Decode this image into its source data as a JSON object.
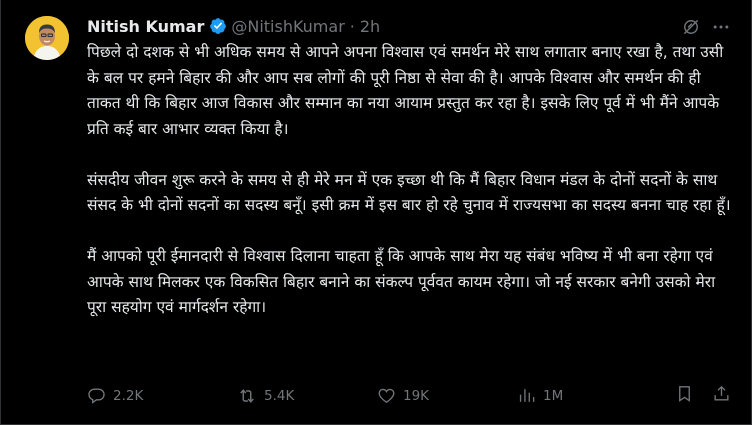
{
  "author": {
    "name": "Nitish Kumar",
    "handle": "@NitishKumar",
    "separator": "·",
    "time": "2h"
  },
  "body": {
    "p1": "पिछले दो दशक से भी अधिक समय से आपने अपना विश्वास एवं समर्थन मेरे साथ लगातार बनाए रखा है, तथा उसी के बल पर हमने बिहार की और आप सब लोगों की पूरी निष्ठा से सेवा की है। आपके विश्वास और समर्थन की ही ताकत थी कि बिहार आज विकास और सम्मान का नया आयाम प्रस्तुत कर रहा है। इसके लिए पूर्व में भी मैंने आपके प्रति कई बार आभार व्यक्त किया है।",
    "p2": "संसदीय जीवन शुरू करने के समय से ही मेरे मन में एक इच्छा थी कि मैं बिहार विधान मंडल के दोनों सदनों के साथ संसद के भी दोनों सदनों का सदस्य बनूँ। इसी क्रम में इस बार हो रहे चुनाव में राज्यसभा का सदस्य बनना चाह रहा हूँ।",
    "p3": "मैं आपको पूरी ईमानदारी से विश्वास दिलाना चाहता हूँ कि आपके साथ मेरा यह संबंध भविष्य में भी बना रहेगा एवं आपके साथ मिलकर एक विकसित बिहार बनाने का संकल्प पूर्ववत कायम रहेगा। जो नई सरकार बनेगी उसको मेरा पूरा सहयोग एवं मार्गदर्शन रहेगा।"
  },
  "stats": {
    "replies": "2.2K",
    "reposts": "5.4K",
    "likes": "19K",
    "views": "1M"
  },
  "icons": {
    "verified": "verified-badge-icon",
    "grok": "grok-icon",
    "more": "more-icon",
    "reply": "reply-icon",
    "repost": "repost-icon",
    "like": "like-icon",
    "views": "views-icon",
    "bookmark": "bookmark-icon",
    "share": "share-icon"
  },
  "colors": {
    "background": "#000000",
    "text": "#e7e9ea",
    "muted": "#71767b",
    "verified": "#1d9bf0",
    "avatar_bg": "#f2c230"
  }
}
